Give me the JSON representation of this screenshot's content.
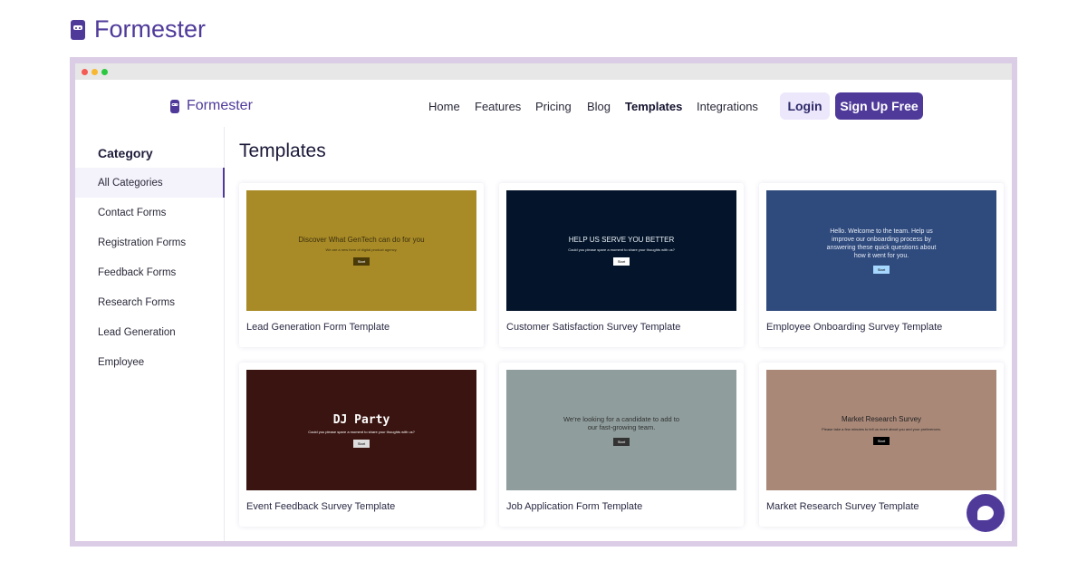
{
  "brand": {
    "name": "Formester",
    "color": "#4f3a9a"
  },
  "nav": {
    "items": [
      "Home",
      "Features",
      "Pricing",
      "Blog",
      "Templates",
      "Integrations"
    ],
    "active": "Templates",
    "login": "Login",
    "signup": "Sign Up Free"
  },
  "sidebar": {
    "heading": "Category",
    "items": [
      "All Categories",
      "Contact Forms",
      "Registration Forms",
      "Feedback Forms",
      "Research Forms",
      "Lead Generation",
      "Employee"
    ]
  },
  "main": {
    "title": "Templates",
    "cards": [
      {
        "title": "Lead Generation Form Template",
        "heading": "Discover What GenTech can do for you",
        "sub": "We are a new form of digital product agency.",
        "start": "Start",
        "bg": "#a88a26"
      },
      {
        "title": "Customer Satisfaction Survey Template",
        "heading": "HELP US SERVE YOU BETTER",
        "sub": "Could you please spare a moment to share your thoughts with us?",
        "start": "Start",
        "bg": "#04152b"
      },
      {
        "title": "Employee Onboarding Survey Template",
        "heading": "Hello. Welcome to the team. Help us improve our onboarding process by answering these quick questions about how it went for you.",
        "sub": "",
        "start": "Start",
        "bg": "#2f4a7c"
      },
      {
        "title": "Event Feedback Survey Template",
        "heading": "DJ Party",
        "sub": "Could you please spare a moment to share your thoughts with us?",
        "start": "Start",
        "bg": "#3a1410"
      },
      {
        "title": "Job Application Form Template",
        "heading": "We're looking for a candidate to add to our fast-growing team.",
        "sub": "",
        "start": "Start",
        "bg": "#8f9d9c"
      },
      {
        "title": "Market Research Survey Template",
        "heading": "Market Research Survey",
        "sub": "Please take a few minutes to tell us more about you and your preferences.",
        "start": "Start",
        "bg": "#a98878"
      }
    ]
  }
}
